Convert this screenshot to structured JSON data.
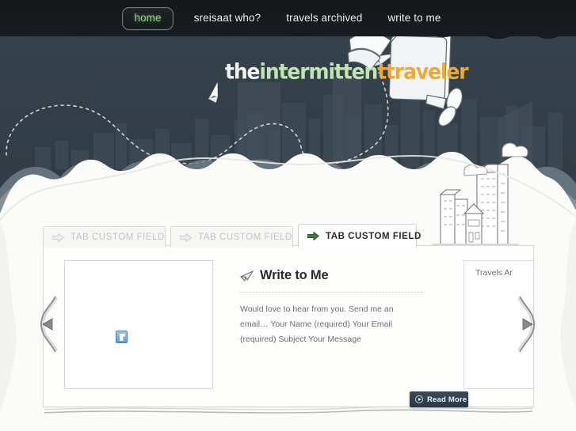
{
  "site": {
    "logo": {
      "part1": "the",
      "part2": "intermitten",
      "part3": "t",
      "part4": "traveler",
      "color_white": "#f2f4f4",
      "color_green": "#bfe6b2",
      "color_orange": "#f0a92b"
    }
  },
  "nav": {
    "items": [
      {
        "label": "home",
        "active": true
      },
      {
        "label": "sreisaat who?",
        "active": false
      },
      {
        "label": "travels archived",
        "active": false
      },
      {
        "label": "write to me",
        "active": false
      }
    ]
  },
  "tabs": [
    {
      "label": "TAB CUSTOM FIELD",
      "active": false,
      "icon": "arrow-right-icon"
    },
    {
      "label": "TAB CUSTOM FIELD",
      "active": false,
      "icon": "arrow-right-icon"
    },
    {
      "label": "TAB CUSTOM FIELD",
      "active": true,
      "icon": "arrow-right-icon"
    }
  ],
  "article": {
    "title": "Write to Me",
    "icon": "paper-plane-icon",
    "body": "Would love to hear from you. Send me an email… Your Name (required) Your Email (required) Subject Your Message",
    "read_more": "Read More",
    "thumbnail_icon": "broken-image-icon"
  },
  "side_panel": {
    "title": "Travels Ar"
  },
  "carousel": {
    "prev_icon": "triangle-left-icon",
    "next_icon": "triangle-right-icon"
  },
  "theme": {
    "sky_dark": "#171a1e",
    "sky": "#36424c",
    "paper": "#fbfbfa",
    "accent_green": "#8fd08a",
    "accent_orange": "#f0a92b",
    "button_navy": "#2c3846"
  }
}
